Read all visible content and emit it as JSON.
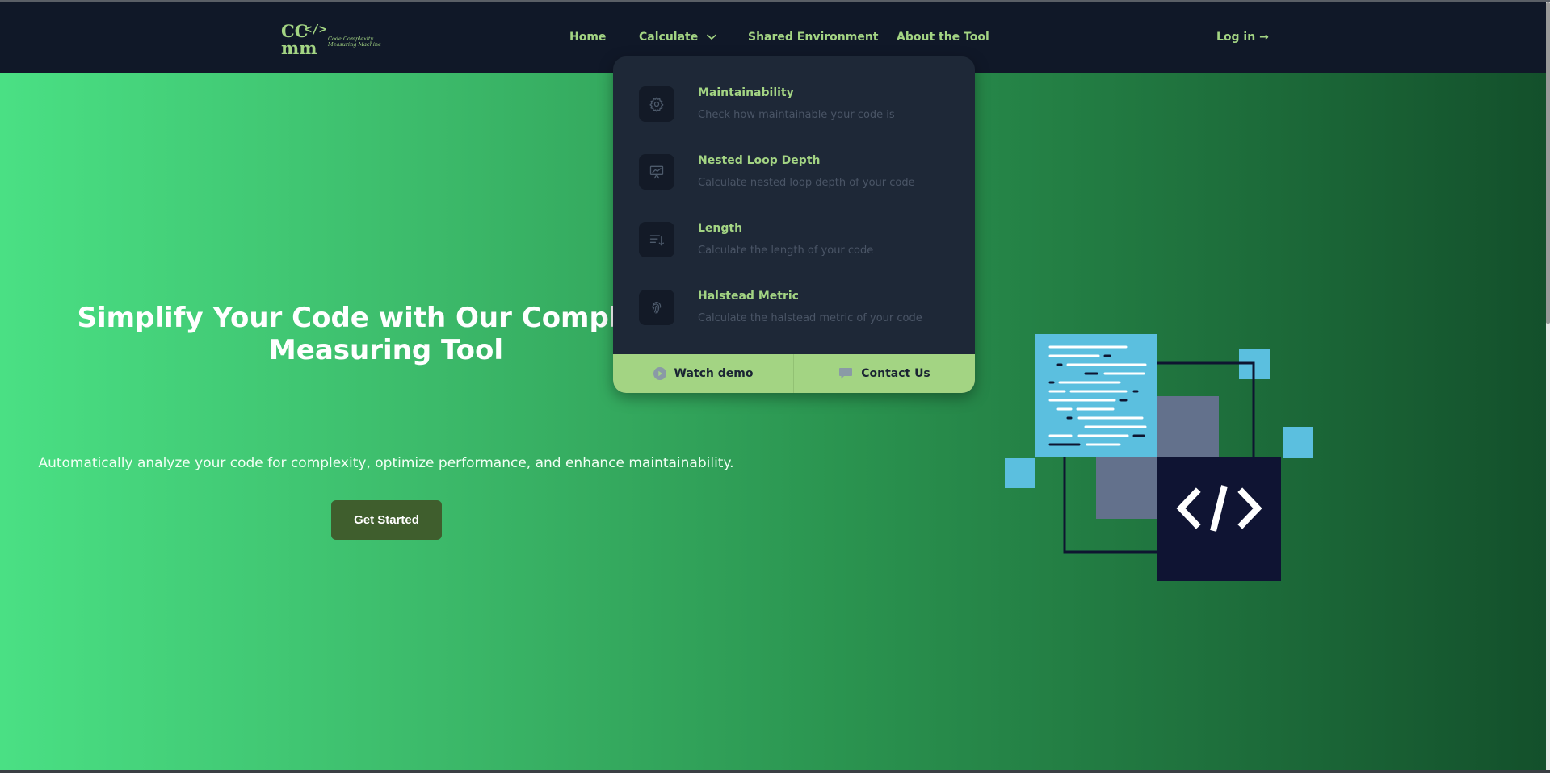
{
  "brand": {
    "logo_letters_top": "CC",
    "logo_letters_bottom": "mm",
    "logo_code_glyph": "</>",
    "logo_tagline_line1": "Code Complexity",
    "logo_tagline_line2": "Measuring Machine"
  },
  "nav": {
    "home": "Home",
    "calculate": "Calculate",
    "shared": "Shared Environment",
    "about": "About the Tool",
    "login": "Log in →"
  },
  "dropdown": {
    "items": [
      {
        "title": "Maintainability",
        "desc": "Check how maintainable your code is",
        "icon": "gear-icon"
      },
      {
        "title": "Nested Loop Depth",
        "desc": "Calculate nested loop depth of your code",
        "icon": "presentation-chart-icon"
      },
      {
        "title": "Length",
        "desc": "Calculate the length of your code",
        "icon": "sort-lines-icon"
      },
      {
        "title": "Halstead Metric",
        "desc": "Calculate the halstead metric of your code",
        "icon": "fingerprint-icon"
      }
    ],
    "footer": {
      "watch_demo": "Watch demo",
      "contact_us": "Contact Us"
    }
  },
  "hero": {
    "title": "Simplify Your Code with Our Complexity Measuring Tool",
    "subtitle": "Automatically analyze your code for complexity, optimize performance, and enhance maintainability.",
    "cta": "Get Started"
  },
  "colors": {
    "accent": "#a3d483",
    "nav_bg": "#101828",
    "dropdown_bg": "#1e2837",
    "cta_bg": "#3f5e2d",
    "hero_gradient_start": "#4ae084",
    "hero_gradient_end": "#13502b"
  }
}
